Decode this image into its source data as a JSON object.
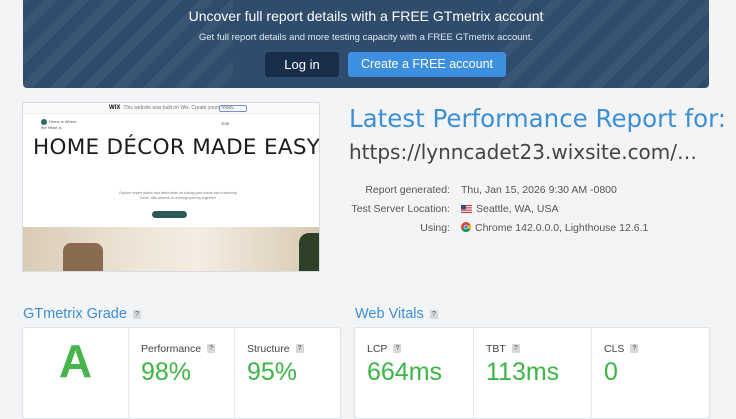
{
  "banner": {
    "title": "Uncover full report details with a FREE GTmetrix account",
    "subtitle": "Get full report details and more testing capacity with a FREE GTmetrix account.",
    "login_label": "Log in",
    "create_label": "Create a FREE account"
  },
  "thumbnail": {
    "wix_logo": "WIX",
    "wix_notice": "This website was built on Wix. Create yours today.",
    "brand": "Home is Where the Heart is",
    "nav": "Join",
    "hero": "HOME DÉCOR MADE EASY",
    "copy": "Explore expert advice and fresh ideas for turning your house into a stunning home, with artwork on a design journey together!"
  },
  "report": {
    "title": "Latest Performance Report for:",
    "url": "https://lynncadet23.wixsite.com/home...",
    "meta": [
      {
        "label": "Report generated:",
        "value": "Thu, Jan 15, 2026 9:30 AM -0800",
        "icon": ""
      },
      {
        "label": "Test Server Location:",
        "value": "Seattle, WA, USA",
        "icon": "us-flag-icon"
      },
      {
        "label": "Using:",
        "value": "Chrome 142.0.0.0, Lighthouse 12.6.1",
        "icon": "chrome-icon"
      }
    ]
  },
  "grade": {
    "title": "GTmetrix Grade",
    "help": "?",
    "letter": "A",
    "performance_label": "Performance",
    "performance_value": "98%",
    "structure_label": "Structure",
    "structure_value": "95%"
  },
  "vitals": {
    "title": "Web Vitals",
    "help": "?",
    "items": [
      {
        "label": "LCP",
        "value": "664ms"
      },
      {
        "label": "TBT",
        "value": "113ms"
      },
      {
        "label": "CLS",
        "value": "0"
      }
    ]
  },
  "colors": {
    "banner_bg": "#2f4c6d",
    "accent_blue": "#3d8fd4",
    "grade_green": "#3cb544",
    "login_btn": "#172d49",
    "create_btn": "#3d8fe0"
  }
}
